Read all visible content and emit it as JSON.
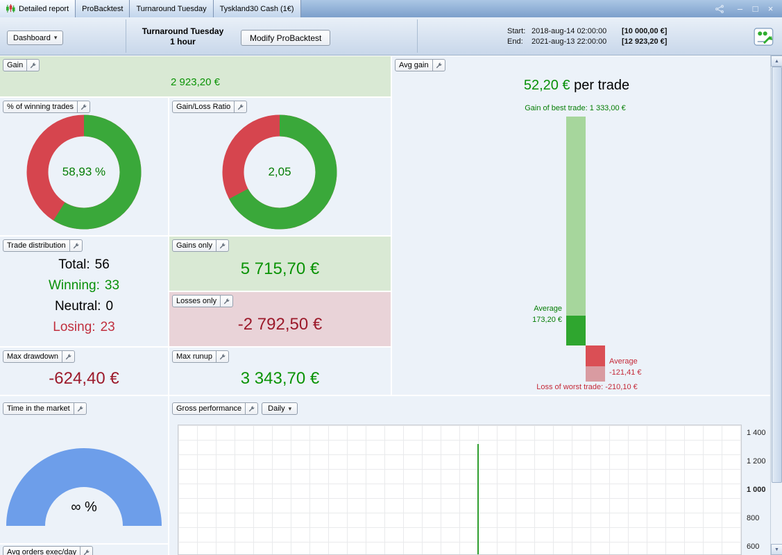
{
  "titlebar": {
    "tabs": [
      {
        "label": "Detailed report"
      },
      {
        "label": "ProBacktest"
      },
      {
        "label": "Turnaround Tuesday"
      },
      {
        "label": "Tyskland30 Cash (1€)"
      }
    ]
  },
  "icons": {
    "minimize": "–",
    "maximize": "□",
    "close": "×",
    "caret_down": "▾",
    "scroll_up": "▲",
    "scroll_down": "▼"
  },
  "toolbar": {
    "dashboard_button": "Dashboard",
    "strategy_name": "Turnaround Tuesday",
    "timeframe": "1 hour",
    "modify_button": "Modify ProBacktest",
    "start_label": "Start:",
    "start_datetime": "2018-aug-14 02:00:00",
    "start_amount": "[10 000,00 €]",
    "end_label": "End:",
    "end_datetime": "2021-aug-13 22:00:00",
    "end_amount": "[12 923,20 €]"
  },
  "panels": {
    "gain": {
      "title": "Gain",
      "value": "2 923,20 €"
    },
    "winning_trades": {
      "title": "% of winning trades",
      "value": "58,93 %",
      "green_pct": 58.93
    },
    "gain_loss_ratio": {
      "title": "Gain/Loss Ratio",
      "value": "2,05",
      "green_pct": 67.2
    },
    "avg_gain": {
      "title": "Avg gain",
      "value": "52,20 €",
      "value_suffix": " per trade",
      "best_trade_label": "Gain of best trade: 1 333,00 €",
      "avg_gain_word": "Average",
      "avg_gain_value": "173,20 €",
      "avg_loss_word": "Average",
      "avg_loss_value": "-121,41 €",
      "worst_trade_label": "Loss of worst trade: -210,10 €"
    },
    "trade_distribution": {
      "title": "Trade distribution",
      "rows": [
        {
          "label": "Total:",
          "value": "56"
        },
        {
          "label": "Winning:",
          "value": "33"
        },
        {
          "label": "Neutral:",
          "value": "0"
        },
        {
          "label": "Losing:",
          "value": "23"
        }
      ]
    },
    "gains_only": {
      "title": "Gains only",
      "value": "5 715,70 €"
    },
    "losses_only": {
      "title": "Losses only",
      "value": "-2 792,50 €"
    },
    "max_drawdown": {
      "title": "Max drawdown",
      "value": "-624,40 €"
    },
    "max_runup": {
      "title": "Max runup",
      "value": "3 343,70 €"
    },
    "time_in_market": {
      "title": "Time in the market",
      "value": "∞ %"
    },
    "gross_performance": {
      "title": "Gross performance",
      "period_button": "Daily",
      "y_ticks": [
        "1 400",
        "1 200",
        "1 000",
        "800",
        "600"
      ]
    },
    "avg_orders": {
      "title": "Avg orders exec/day"
    }
  },
  "chart_data": [
    {
      "type": "pie",
      "title": "% of winning trades",
      "slices": [
        {
          "label": "winning",
          "value": 58.93
        },
        {
          "label": "losing",
          "value": 41.07
        }
      ],
      "center_label": "58,93 %"
    },
    {
      "type": "pie",
      "title": "Gain/Loss Ratio",
      "slices": [
        {
          "label": "gains",
          "value": 67.2
        },
        {
          "label": "losses",
          "value": 32.8
        }
      ],
      "center_label": "2,05"
    },
    {
      "type": "bar",
      "title": "Avg gain per trade (€)",
      "bars": {
        "best_trade": 1333.0,
        "average_gain": 173.2,
        "average_loss": -121.41,
        "worst_trade": -210.1
      }
    },
    {
      "type": "line",
      "title": "Gross performance (Daily)",
      "y_ticks": [
        1400,
        1200,
        1000,
        800,
        600
      ],
      "visible_series": "single green vertical spike at ~53% of plot width reaching ~1330"
    }
  ],
  "colors": {
    "positive_green": "#089008",
    "negative_red": "#9c1a2b",
    "donut_green": "#3aa83a",
    "donut_red": "#d6454e",
    "bar_light_green": "#a6d69c",
    "bar_dark_green": "#2fa62f",
    "bar_dark_red": "#da4f55",
    "bar_light_red": "#d99ba1",
    "gauge_blue": "#6d9eea",
    "panel_green_bg": "#d9e9d4",
    "panel_red_bg": "#e9d3d8"
  }
}
